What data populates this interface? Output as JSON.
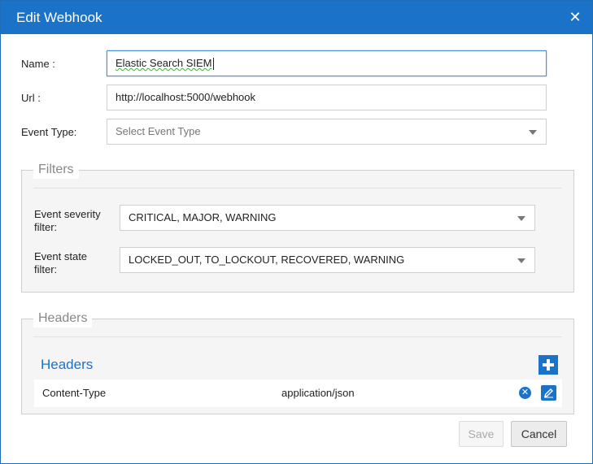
{
  "dialog": {
    "title": "Edit Webhook",
    "close_symbol": "✕"
  },
  "form": {
    "name_label": "Name :",
    "name_value": "Elastic Search SIEM",
    "url_label": "Url :",
    "url_value": "http://localhost:5000/webhook",
    "event_type_label": "Event Type:",
    "event_type_placeholder": "Select Event Type"
  },
  "filters": {
    "legend": "Filters",
    "severity_label_line1": "Event severity",
    "severity_label_line2": "filter:",
    "severity_value": "CRITICAL, MAJOR, WARNING",
    "state_label_line1": "Event state",
    "state_label_line2": "filter:",
    "state_value": "LOCKED_OUT, TO_LOCKOUT, RECOVERED, WARNING"
  },
  "headers": {
    "legend": "Headers",
    "panel_title": "Headers",
    "rows": [
      {
        "key": "Content-Type",
        "value": "application/json"
      }
    ]
  },
  "footer": {
    "save_label": "Save",
    "cancel_label": "Cancel"
  },
  "colors": {
    "accent": "#1a73c9"
  },
  "icons": {
    "close": "close-icon",
    "dropdown": "chevron-down-icon",
    "add": "plus-icon",
    "remove": "remove-circle-icon",
    "edit": "pencil-icon"
  }
}
